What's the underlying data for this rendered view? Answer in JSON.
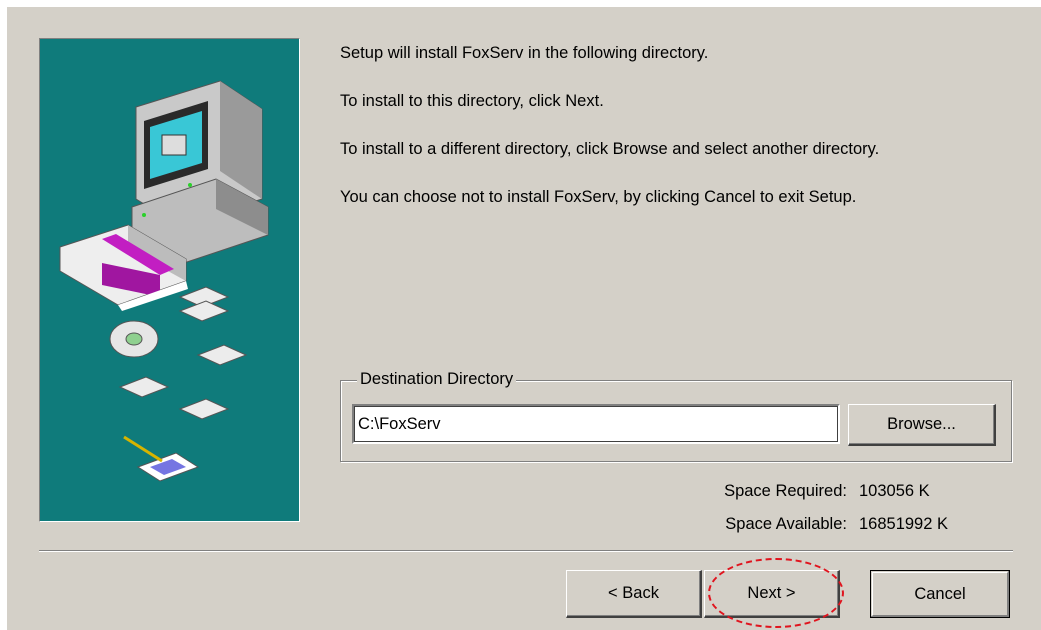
{
  "intro": {
    "line1": "Setup will install FoxServ in the following directory.",
    "line2": "To install to this directory, click Next.",
    "line3": "To install to a different directory, click Browse and select another directory.",
    "line4": "You can choose not to install FoxServ, by clicking Cancel to exit Setup."
  },
  "destination": {
    "legend": "Destination Directory",
    "path": "C:\\FoxServ",
    "browse_label": "Browse..."
  },
  "space": {
    "required_label": "Space Required:",
    "required_value": "103056 K",
    "available_label": "Space Available:",
    "available_value": "16851992 K"
  },
  "buttons": {
    "back_label": "< Back",
    "next_label": "Next >",
    "cancel_label": "Cancel"
  },
  "colors": {
    "dialog_bg": "#d4d0c8",
    "art_bg": "#0f7b7b",
    "highlight": "#e0141e"
  }
}
